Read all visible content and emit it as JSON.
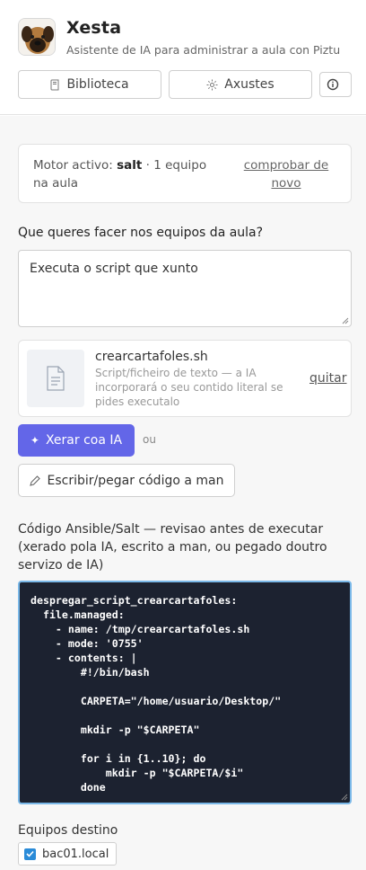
{
  "app": {
    "title": "Xesta",
    "subtitle": "Asistente de IA para administrar a aula con Piztu"
  },
  "header_buttons": {
    "library": "Biblioteca",
    "settings": "Axustes",
    "info_icon": "info-icon"
  },
  "engine": {
    "prefix": "Motor activo: ",
    "name": "salt",
    "suffix": " · 1 equipo na aula",
    "link": "comprobar de novo"
  },
  "prompt": {
    "label": "Que queres facer nos equipos da aula?",
    "value": "Executa o script que xunto"
  },
  "attachment": {
    "filename": "crearcartafoles.sh",
    "description": "Script/ficheiro de texto — a IA incorporará o seu contido literal se pides executalo",
    "remove": "quitar",
    "icon": "document-icon"
  },
  "actions": {
    "generate": "Xerar coa IA",
    "or": "ou",
    "manual": "Escribir/pegar código a man"
  },
  "code": {
    "label": "Código Ansible/Salt — revisao antes de executar (xerado pola IA, escrito a man, ou pegado doutro servizo de IA)",
    "content": "despregar_script_crearcartafoles:\n  file.managed:\n    - name: /tmp/crearcartafoles.sh\n    - mode: '0755'\n    - contents: |\n        #!/bin/bash\n\n        CARPETA=\"/home/usuario/Desktop/\"\n\n        mkdir -p \"$CARPETA\"\n\n        for i in {1..10}; do\n            mkdir -p \"$CARPETA/$i\"\n        done"
  },
  "targets": {
    "label": "Equipos destino",
    "items": [
      {
        "name": "bac01.local",
        "checked": true
      }
    ]
  },
  "colors": {
    "accent": "#6366e8",
    "code_bg": "#1c2230",
    "code_border": "#7ab8e8",
    "checkbox": "#2a8bd8"
  }
}
